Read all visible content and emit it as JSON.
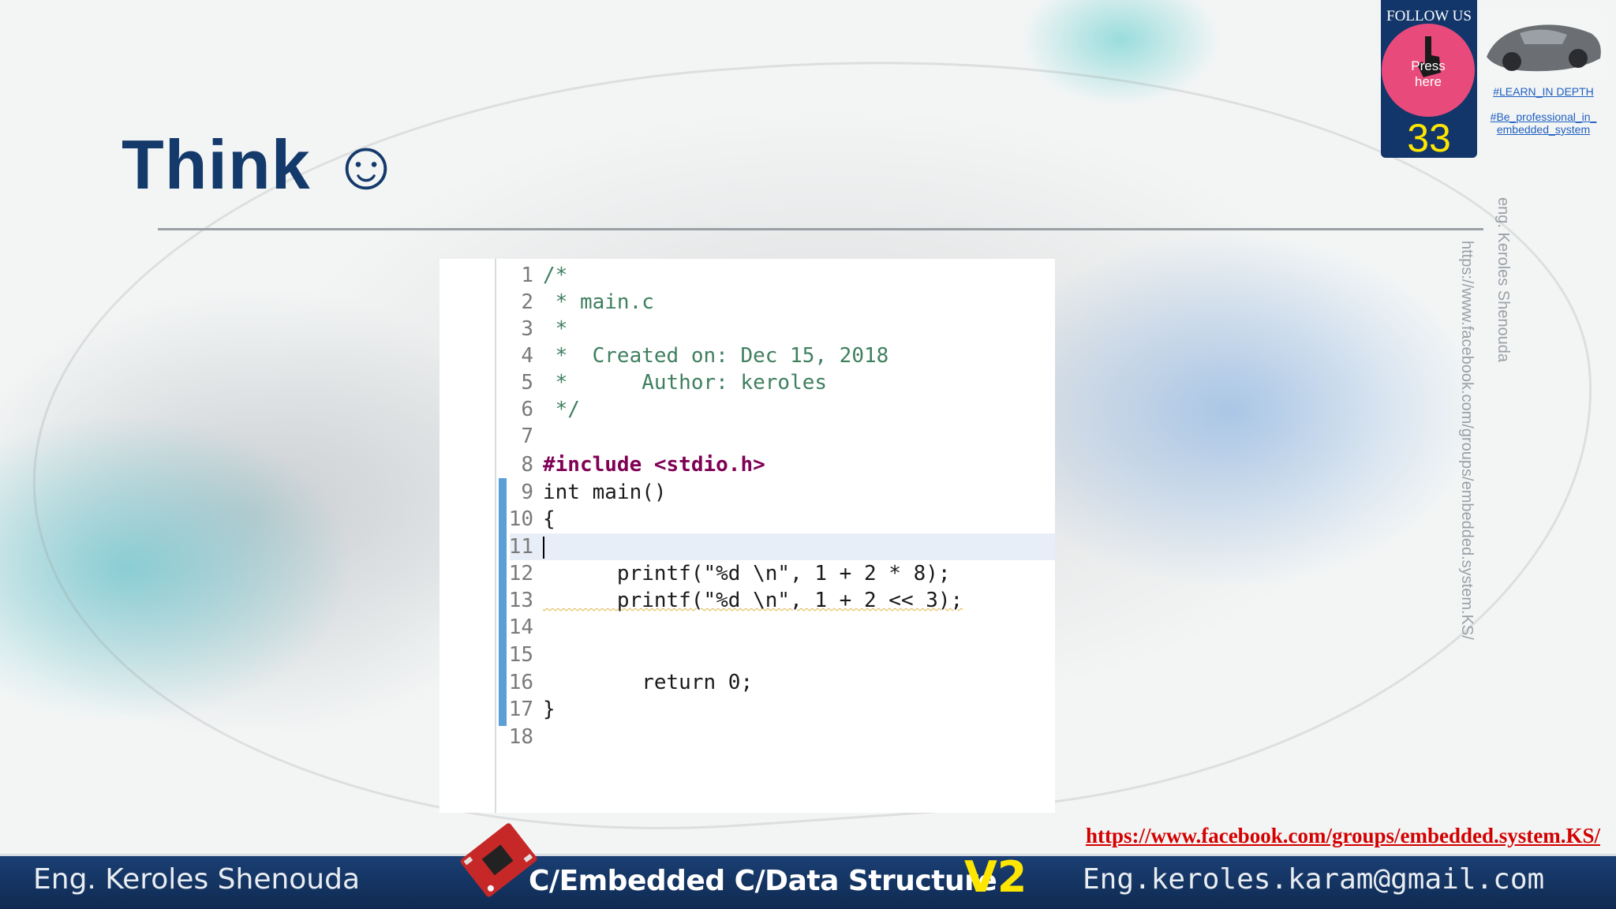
{
  "slide": {
    "title": "Think ☺",
    "page_number": "33"
  },
  "follow": {
    "label": "FOLLOW US",
    "press_label": "Press\nhere",
    "tag_learn": "#LEARN_IN DEPTH",
    "tag_professional": "#Be_professional_in_\nembedded_system"
  },
  "code": {
    "lines": [
      {
        "n": "1",
        "text": "/*"
      },
      {
        "n": "2",
        "text": " * main.c"
      },
      {
        "n": "3",
        "text": " *"
      },
      {
        "n": "4",
        "text": " *  Created on: Dec 15, 2018"
      },
      {
        "n": "5",
        "text": " *      Author: keroles"
      },
      {
        "n": "6",
        "text": " */"
      },
      {
        "n": "7",
        "text": ""
      },
      {
        "n": "8",
        "text": "#include <stdio.h>"
      },
      {
        "n": "9",
        "text": "int main()"
      },
      {
        "n": "10",
        "text": "{"
      },
      {
        "n": "11",
        "text": ""
      },
      {
        "n": "12",
        "text": "      printf(\"%d \\n\", 1 + 2 * 8);"
      },
      {
        "n": "13",
        "text": "      printf(\"%d \\n\", 1 + 2 << 3);"
      },
      {
        "n": "14",
        "text": ""
      },
      {
        "n": "15",
        "text": ""
      },
      {
        "n": "16",
        "text": "        return 0;"
      },
      {
        "n": "17",
        "text": "}"
      },
      {
        "n": "18",
        "text": ""
      }
    ]
  },
  "side_text": {
    "author_vertical": "eng. Keroles Shenouda",
    "url_vertical": "https://www.facebook.com/groups/embedded.system.KS/"
  },
  "footer": {
    "link": "https://www.facebook.com/groups/embedded.system.KS/",
    "author": "Eng. Keroles Shenouda",
    "course": "C/Embedded C/Data Structure",
    "version": "V2",
    "email": "Eng.keroles.karam@gmail.com"
  },
  "colors": {
    "title": "#143a6b",
    "footer_bg": "#12366a",
    "link": "#d40000",
    "accent_yellow": "#ffe600",
    "press_button": "#e84b7b"
  }
}
